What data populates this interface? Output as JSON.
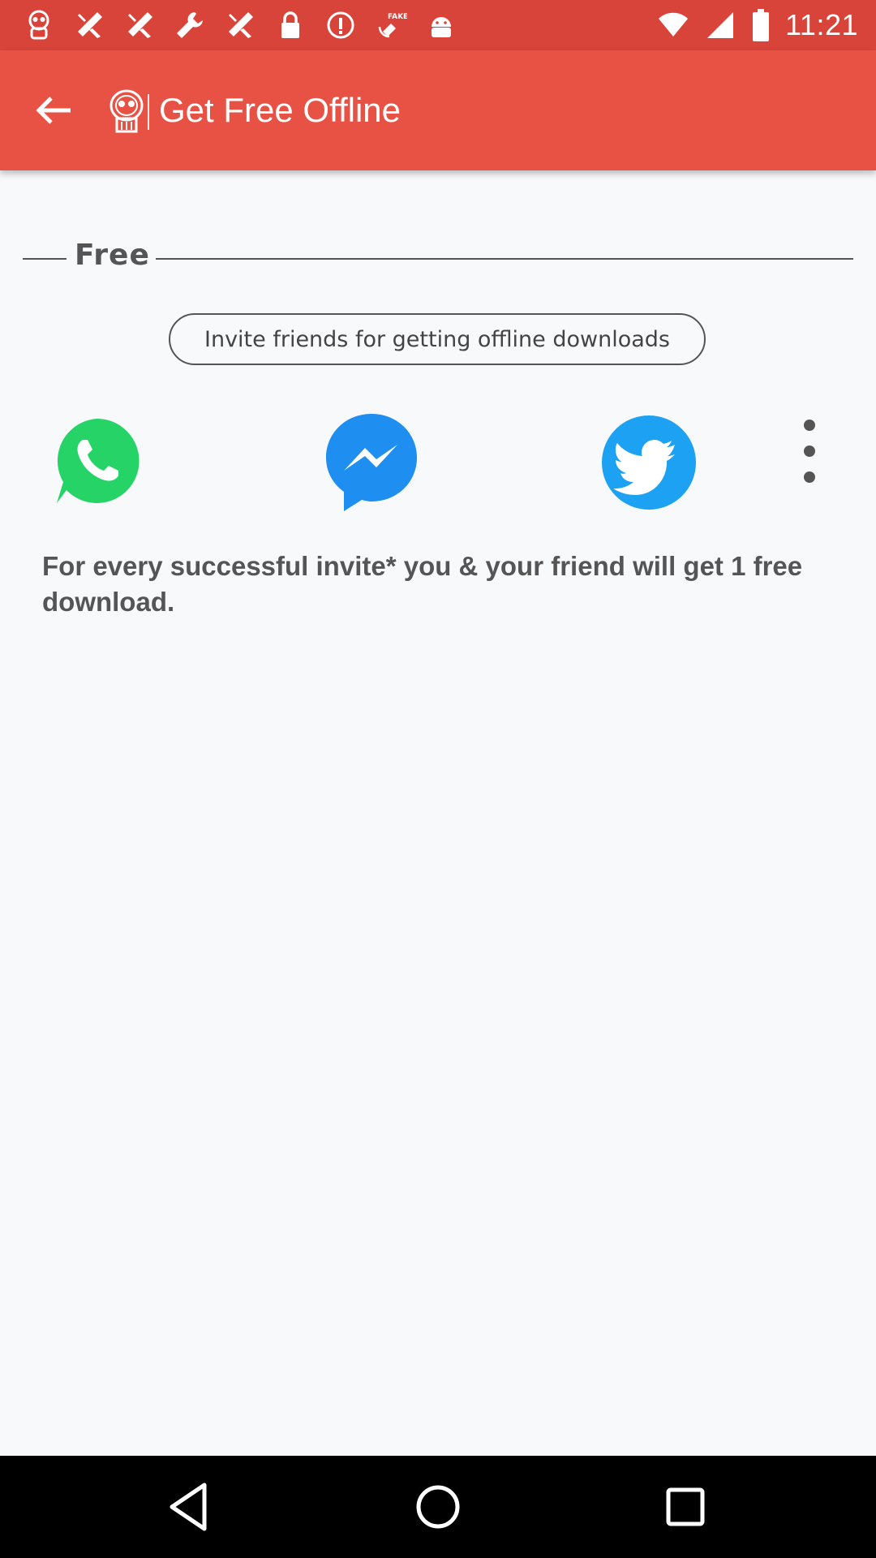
{
  "status_bar": {
    "time": "11:21",
    "left_icons": [
      "app-logo-icon",
      "crossed-tools-icon",
      "crossed-tools-icon",
      "wrench-icon",
      "crossed-tools-icon",
      "lock-icon",
      "info-icon",
      "fake-gps-icon",
      "android-icon"
    ],
    "right_icons": [
      "wifi-icon",
      "signal-icon",
      "battery-icon"
    ]
  },
  "app_bar": {
    "title": "Get Free Offline",
    "back_icon": "arrow-back-icon",
    "color": "#e85244"
  },
  "section": {
    "heading": "Free",
    "invite_label": "Invite friends for getting offline downloads",
    "share_targets": [
      {
        "name": "WhatsApp",
        "icon": "whatsapp-icon",
        "color": "#25d366"
      },
      {
        "name": "Messenger",
        "icon": "messenger-icon",
        "color": "#1f8ef1"
      },
      {
        "name": "Twitter",
        "icon": "twitter-icon",
        "color": "#1da1f2"
      },
      {
        "name": "More",
        "icon": "more-vert-icon",
        "color": "#555555"
      }
    ],
    "info": "For every successful invite* you & your friend will get 1 free download."
  },
  "nav_bar": {
    "buttons": [
      "back-triangle-icon",
      "home-circle-icon",
      "recents-square-icon"
    ]
  }
}
